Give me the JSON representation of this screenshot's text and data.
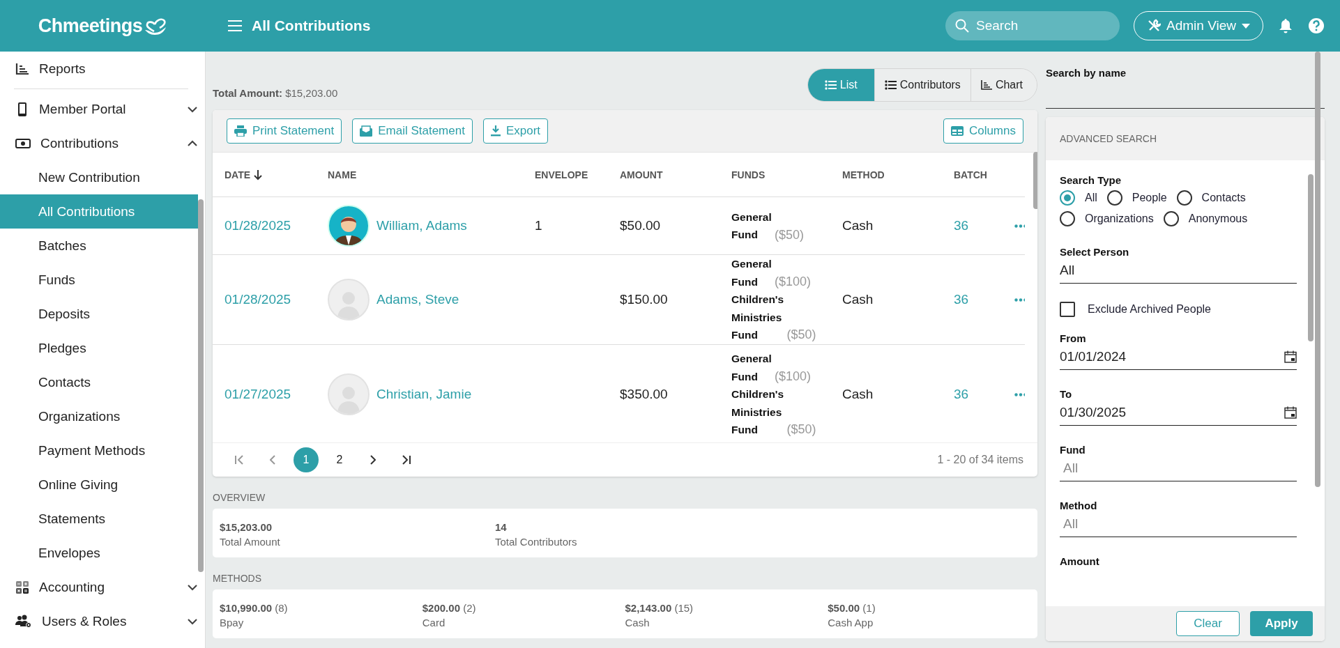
{
  "header": {
    "logo": "Chmeetings",
    "title": "All Contributions",
    "search": {
      "placeholder": "Search"
    },
    "admin_button": "Admin View"
  },
  "sidebar": {
    "items": [
      {
        "label": "Reports"
      },
      {
        "label": "Member Portal",
        "expanded": false
      },
      {
        "label": "Contributions",
        "expanded": true,
        "children": [
          {
            "label": "New Contribution",
            "selected": false
          },
          {
            "label": "All Contributions",
            "selected": true
          },
          {
            "label": "Batches",
            "selected": false
          },
          {
            "label": "Funds",
            "selected": false
          },
          {
            "label": "Deposits",
            "selected": false
          },
          {
            "label": "Pledges",
            "selected": false
          },
          {
            "label": "Contacts",
            "selected": false
          },
          {
            "label": "Organizations",
            "selected": false
          },
          {
            "label": "Payment Methods",
            "selected": false
          },
          {
            "label": "Online Giving",
            "selected": false
          },
          {
            "label": "Statements",
            "selected": false
          },
          {
            "label": "Envelopes",
            "selected": false
          }
        ]
      },
      {
        "label": "Accounting",
        "expanded": false
      },
      {
        "label": "Users & Roles",
        "expanded": false
      }
    ]
  },
  "total": {
    "label": "Total Amount:",
    "value": "$15,203.00"
  },
  "view_tabs": [
    {
      "label": "List",
      "selected": true
    },
    {
      "label": "Contributors",
      "selected": false
    },
    {
      "label": "Chart",
      "selected": false
    }
  ],
  "toolbar": [
    {
      "label": "Print Statement"
    },
    {
      "label": "Email Statement"
    },
    {
      "label": "Export"
    }
  ],
  "columns_button": "Columns",
  "table": {
    "columns": [
      "DATE",
      "NAME",
      "ENVELOPE",
      "AMOUNT",
      "FUNDS",
      "METHOD",
      "BATCH"
    ],
    "rows": [
      {
        "date": "01/28/2025",
        "name": "William, Adams",
        "has_photo": true,
        "envelope": "1",
        "amount": "$50.00",
        "funds": [
          {
            "name": "General Fund",
            "amount": "($50)"
          }
        ],
        "method": "Cash",
        "batch": "36"
      },
      {
        "date": "01/28/2025",
        "name": "Adams, Steve",
        "has_photo": false,
        "envelope": "",
        "amount": "$150.00",
        "funds": [
          {
            "name": "General Fund",
            "amount": "($100)"
          },
          {
            "name": "Children's Ministries Fund",
            "amount": "($50)"
          }
        ],
        "method": "Cash",
        "batch": "36"
      },
      {
        "date": "01/27/2025",
        "name": "Christian, Jamie",
        "has_photo": false,
        "envelope": "",
        "amount": "$350.00",
        "funds": [
          {
            "name": "General Fund",
            "amount": "($100)"
          },
          {
            "name": "Children's Ministries Fund",
            "amount": "($50)"
          }
        ],
        "method": "Cash",
        "batch": "36"
      }
    ]
  },
  "pagination": {
    "pages": [
      {
        "label": "1",
        "selected": true
      },
      {
        "label": "2",
        "selected": false
      }
    ],
    "summary": "1 - 20 of 34 items"
  },
  "overview": {
    "title": "OVERVIEW",
    "stats": [
      {
        "value": "$15,203.00",
        "label": "Total Amount"
      },
      {
        "value": "14",
        "label": "Total Contributors"
      }
    ]
  },
  "methods": {
    "title": "METHODS",
    "items": [
      {
        "amount": "$10,990.00",
        "count": "(8)",
        "label": "Bpay"
      },
      {
        "amount": "$200.00",
        "count": "(2)",
        "label": "Card"
      },
      {
        "amount": "$2,143.00",
        "count": "(15)",
        "label": "Cash"
      },
      {
        "amount": "$50.00",
        "count": "(1)",
        "label": "Cash App"
      }
    ]
  },
  "search_panel": {
    "name_label": "Search by name",
    "title": "ADVANCED SEARCH",
    "search_type_label": "Search Type",
    "search_types": [
      {
        "label": "All",
        "selected": true
      },
      {
        "label": "People",
        "selected": false
      },
      {
        "label": "Contacts",
        "selected": false
      },
      {
        "label": "Organizations",
        "selected": false
      },
      {
        "label": "Anonymous",
        "selected": false
      }
    ],
    "fields": [
      {
        "kind": "select",
        "label": "Select Person",
        "value": "All"
      },
      {
        "kind": "checkbox",
        "label": "Exclude Archived People",
        "checked": false
      },
      {
        "kind": "date",
        "label": "From",
        "value": "01/01/2024"
      },
      {
        "kind": "date",
        "label": "To",
        "value": "01/30/2025"
      },
      {
        "kind": "multiselect",
        "label": "Fund",
        "placeholder": "All"
      },
      {
        "kind": "multiselect",
        "label": "Method",
        "placeholder": "All"
      },
      {
        "kind": "heading",
        "label": "Amount"
      }
    ],
    "buttons": {
      "clear": "Clear",
      "apply": "Apply"
    }
  }
}
